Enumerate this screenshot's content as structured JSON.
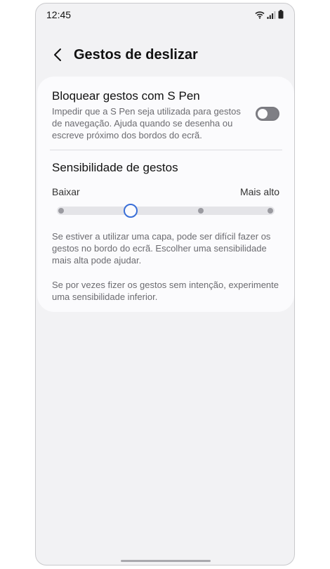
{
  "status_bar": {
    "time": "12:45",
    "icons": [
      "wifi-icon",
      "signal-icon",
      "battery-icon"
    ]
  },
  "header": {
    "back_icon": "chevron-left-icon",
    "title": "Gestos de deslizar"
  },
  "spen_setting": {
    "title": "Bloquear gestos com S Pen",
    "description": "Impedir que a S Pen seja utilizada para gestos de navegação. Ajuda quando se desenha ou escreve próximo dos bordos do ecrã.",
    "enabled": false
  },
  "sensitivity": {
    "title": "Sensibilidade de gestos",
    "low_label": "Baixar",
    "high_label": "Mais alto",
    "steps": 4,
    "selected_step": 2
  },
  "notes": {
    "case_note": "Se estiver a utilizar uma capa, pode ser difícil fazer os gestos no bordo do ecrã. Escolher uma sensibilidade mais alta pode ajudar.",
    "accidental_note": "Se por vezes fizer os gestos sem intenção, experimente uma sensibilidade inferior."
  },
  "colors": {
    "accent": "#3a6fd8",
    "background": "#f2f2f4",
    "card": "#fbfbfd"
  }
}
